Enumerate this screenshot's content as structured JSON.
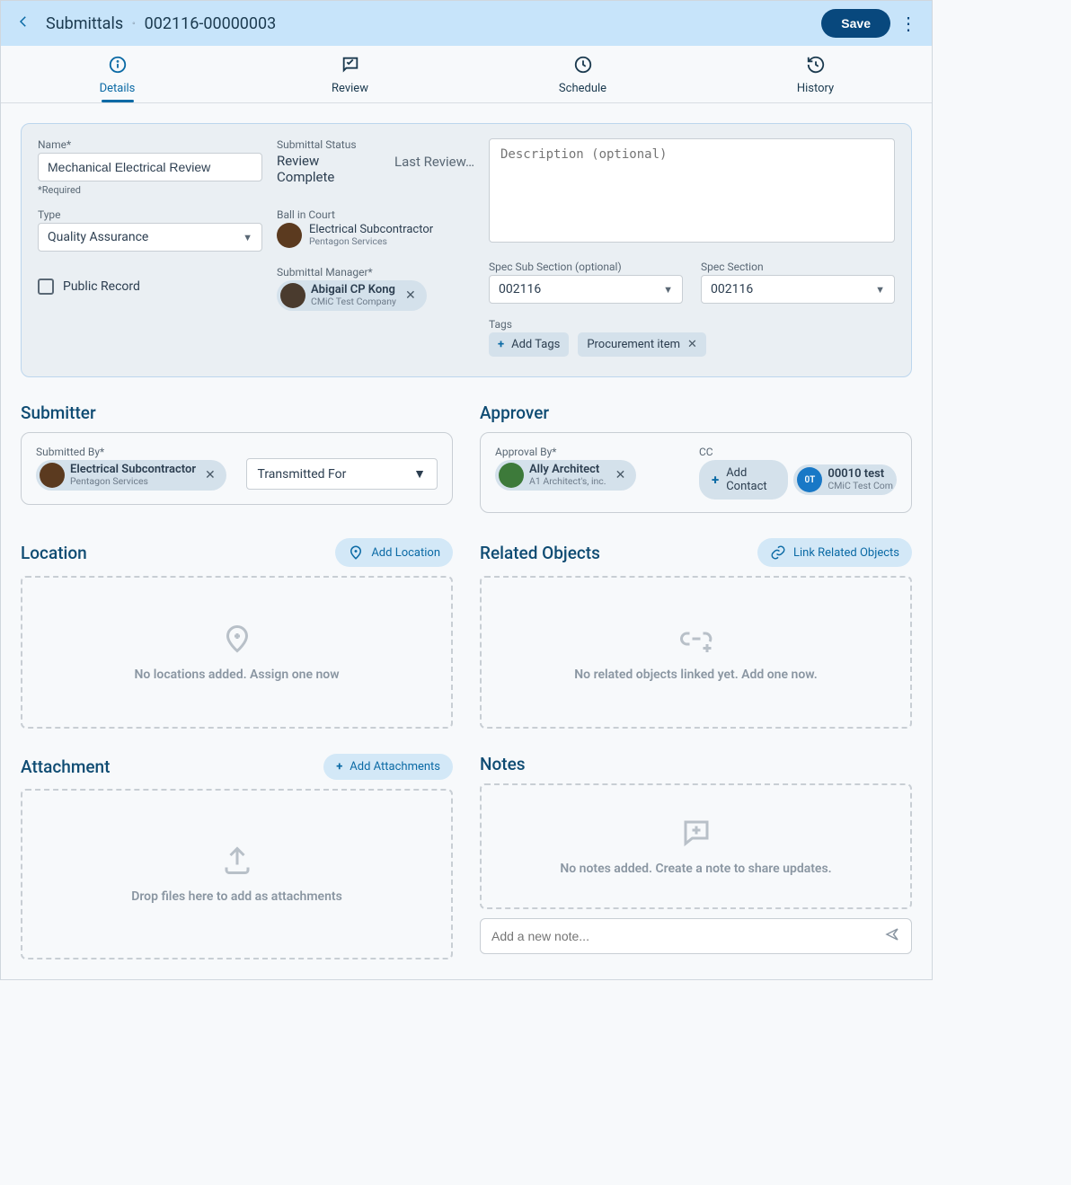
{
  "header": {
    "breadcrumb_root": "Submittals",
    "breadcrumb_id": "002116-00000003",
    "save_label": "Save"
  },
  "tabs": {
    "details": "Details",
    "review": "Review",
    "schedule": "Schedule",
    "history": "History"
  },
  "details": {
    "name_label": "Name*",
    "name_value": "Mechanical Electrical Review",
    "required_note": "*Required",
    "type_label": "Type",
    "type_value": "Quality Assurance",
    "public_record_label": "Public Record",
    "status_label": "Submittal Status",
    "status_value": "Review Complete",
    "last_review_label": "Last Review…",
    "ballincourt_label": "Ball in Court",
    "ballincourt_name": "Electrical Subcontractor",
    "ballincourt_sub": "Pentagon Services",
    "manager_label": "Submittal Manager*",
    "manager_name": "Abigail CP Kong",
    "manager_sub": "CMiC Test Company",
    "desc_placeholder": "Description (optional)",
    "spec_sub_label": "Spec Sub Section (optional)",
    "spec_sub_value": "002116",
    "spec_section_label": "Spec Section",
    "spec_section_value": "002116",
    "tags_label": "Tags",
    "add_tags_label": "Add Tags",
    "tag1": "Procurement item"
  },
  "submitter": {
    "title": "Submitter",
    "by_label": "Submitted By*",
    "by_name": "Electrical Subcontractor",
    "by_sub": "Pentagon Services",
    "transmitted_for": "Transmitted For"
  },
  "approver": {
    "title": "Approver",
    "by_label": "Approval By*",
    "by_name": "Ally Architect",
    "by_sub": "A1 Architect's, inc.",
    "cc_label": "CC",
    "add_contact": "Add Contact",
    "cc_avatar_initials": "0T",
    "cc_name": "00010 test",
    "cc_sub": "CMiC Test Com"
  },
  "location": {
    "title": "Location",
    "add_btn": "Add Location",
    "empty": "No locations added. Assign one now"
  },
  "related": {
    "title": "Related Objects",
    "link_btn": "Link Related Objects",
    "empty": "No related objects linked yet. Add one now."
  },
  "attachment": {
    "title": "Attachment",
    "add_btn": "Add Attachments",
    "empty": "Drop files here to add as attachments"
  },
  "notes": {
    "title": "Notes",
    "empty": "No notes added. Create a note to share updates.",
    "placeholder": "Add a new note..."
  }
}
